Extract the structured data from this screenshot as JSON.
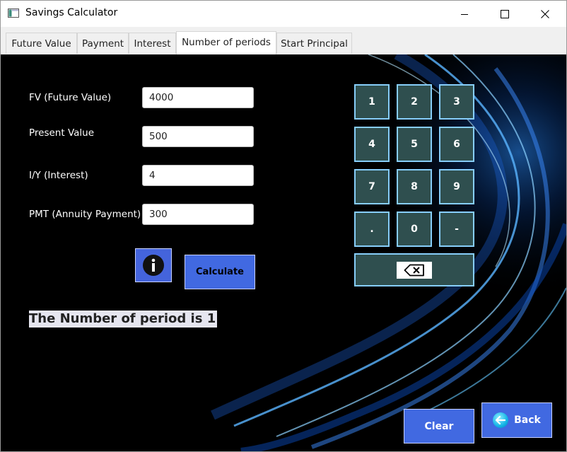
{
  "window": {
    "title": "Savings Calculator",
    "icons": {
      "app": "app-window-icon",
      "minimize": "minimize-icon",
      "maximize": "maximize-icon",
      "close": "close-icon"
    }
  },
  "tabs": [
    {
      "label": "Future Value",
      "active": false
    },
    {
      "label": "Payment",
      "active": false
    },
    {
      "label": "Interest",
      "active": false
    },
    {
      "label": "Number of periods",
      "active": true
    },
    {
      "label": "Start Principal",
      "active": false
    }
  ],
  "form": {
    "fv": {
      "label": "FV (Future Value)",
      "value": "4000"
    },
    "pv": {
      "label": "Present Value",
      "value": "500"
    },
    "iy": {
      "label": "I/Y (Interest)",
      "value": "4"
    },
    "pmt": {
      "label": "PMT (Annuity Payment)",
      "value": "300"
    }
  },
  "buttons": {
    "info_icon": "info-icon",
    "calculate": "Calculate",
    "clear": "Clear",
    "back": "Back",
    "back_icon": "arrow-left-icon"
  },
  "result": "The Number of period is 1",
  "keypad": {
    "keys": [
      "1",
      "2",
      "3",
      "4",
      "5",
      "6",
      "7",
      "8",
      "9",
      ".",
      "0",
      "-"
    ],
    "backspace_icon": "backspace-icon"
  },
  "colors": {
    "button_blue": "#4169E1",
    "key_fill": "#2F4F4F",
    "key_border": "#87CEFA",
    "background": "#000000",
    "result_bg": "#E6E6F0"
  }
}
